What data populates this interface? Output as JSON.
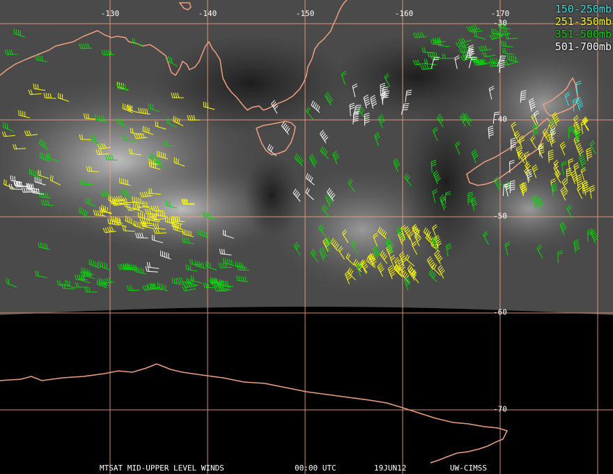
{
  "legend": [
    {
      "label": "150-250mb",
      "color": "#33e6e6"
    },
    {
      "label": "251-350mb",
      "color": "#ffff00"
    },
    {
      "label": "351-500mb",
      "color": "#00dd00"
    },
    {
      "label": "501-700mb",
      "color": "#ffffff"
    }
  ],
  "grid": {
    "longitudes": [
      "-130",
      "-140",
      "-150",
      "-160",
      "-170"
    ],
    "latitudes": [
      "-30",
      "-40",
      "-50",
      "-60",
      "-70"
    ]
  },
  "footer": {
    "product": "MTSAT MID-UPPER LEVEL WINDS",
    "time": "00:00 UTC",
    "date": "19JUN12",
    "source": "UW-CIMSS"
  },
  "colors": {
    "coastline": "#f0a080",
    "gridline": "#f0a080",
    "space_background": "#000000"
  }
}
